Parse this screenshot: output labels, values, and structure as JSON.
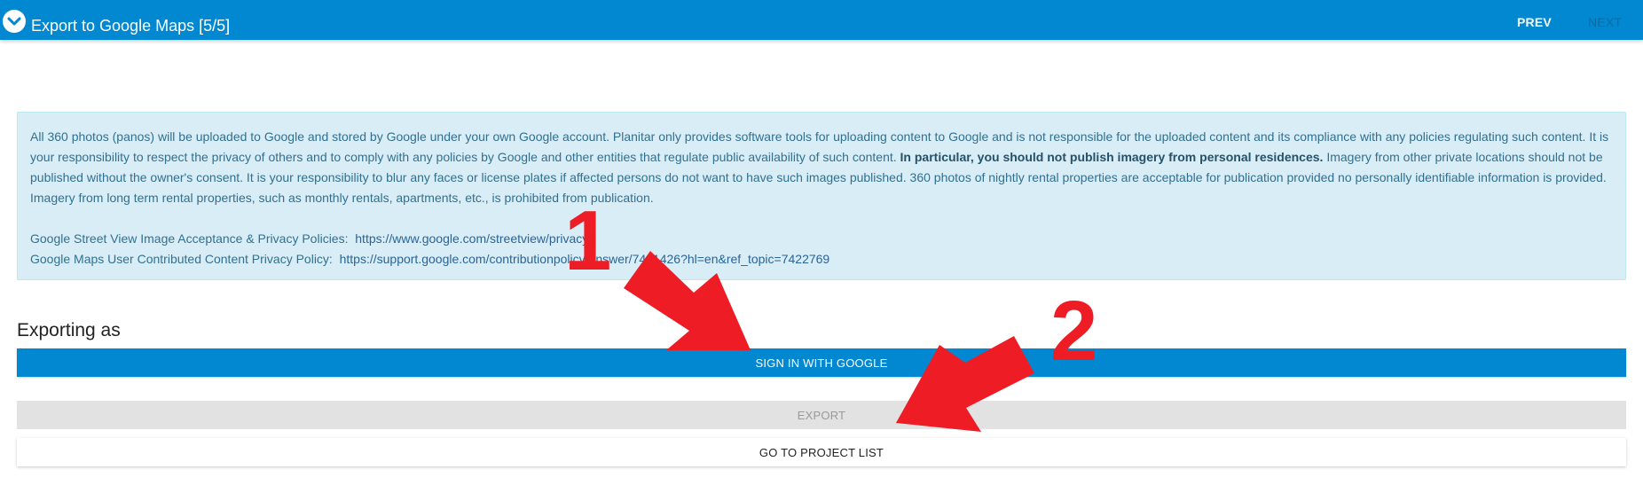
{
  "header": {
    "title": "Export to Google Maps [5/5]",
    "prev_label": "PREV",
    "next_label": "NEXT"
  },
  "info": {
    "para1_a": "All 360 photos (panos) will be uploaded to Google and stored by Google under your own Google account. Planitar only provides software tools for uploading content to Google and is not responsible for the uploaded content and its compliance with any policies regulating such content. It is your responsibility to respect the privacy of others and to comply with any policies by Google and other entities that regulate public availability of such content. ",
    "para1_bold": "In particular, you should not publish imagery from personal residences.",
    "para1_b": " Imagery from other private locations should not be published without the owner's consent. It is your responsibility to blur any faces or license plates if affected persons do not want to have such images published. 360 photos of nightly rental properties are acceptable for publication provided no personally identifiable information is provided. Imagery from long term rental properties, such as monthly rentals, apartments, etc., is prohibited from publication.",
    "policy1_label": "Google Street View Image Acceptance & Privacy Policies:",
    "policy1_url": "https://www.google.com/streetview/privacy/",
    "policy2_label": "Google Maps User Contributed Content Privacy Policy:",
    "policy2_url": "https://support.google.com/contributionpolicy/answer/7401426?hl=en&ref_topic=7422769"
  },
  "export_section": {
    "title": "Exporting as",
    "signin_label": "SIGN IN WITH GOOGLE",
    "export_label": "EXPORT",
    "projects_label": "GO TO PROJECT LIST"
  },
  "annotations": {
    "marker1": "1",
    "marker2": "2",
    "arrow_color": "#ee1c25"
  },
  "colors": {
    "header": "#0288d1",
    "info_bg": "#d9edf7",
    "info_text": "#31708f"
  }
}
